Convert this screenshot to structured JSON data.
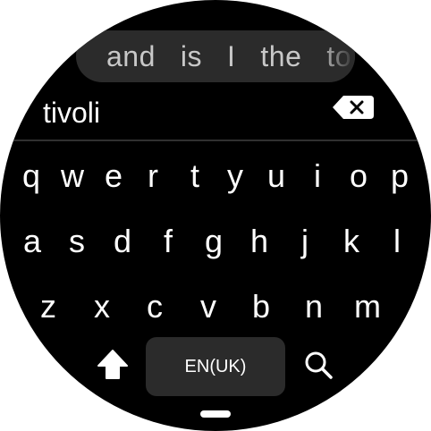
{
  "suggestions": [
    "and",
    "is",
    "I",
    "the",
    "to"
  ],
  "input": {
    "value": "tivoli"
  },
  "keyboard": {
    "row1": [
      "q",
      "w",
      "e",
      "r",
      "t",
      "y",
      "u",
      "i",
      "o",
      "p"
    ],
    "row2": [
      "a",
      "s",
      "d",
      "f",
      "g",
      "h",
      "j",
      "k",
      "l"
    ],
    "row3": [
      "z",
      "x",
      "c",
      "v",
      "b",
      "n",
      "m"
    ],
    "language_label": "EN(UK)"
  },
  "icons": {
    "backspace": "backspace-icon",
    "shift": "shift-arrow-icon",
    "search": "search-icon"
  },
  "colors": {
    "background": "#000000",
    "key_surface": "#2b2b2b",
    "text": "#ffffff",
    "suggestion_text": "#c8c8c8"
  }
}
